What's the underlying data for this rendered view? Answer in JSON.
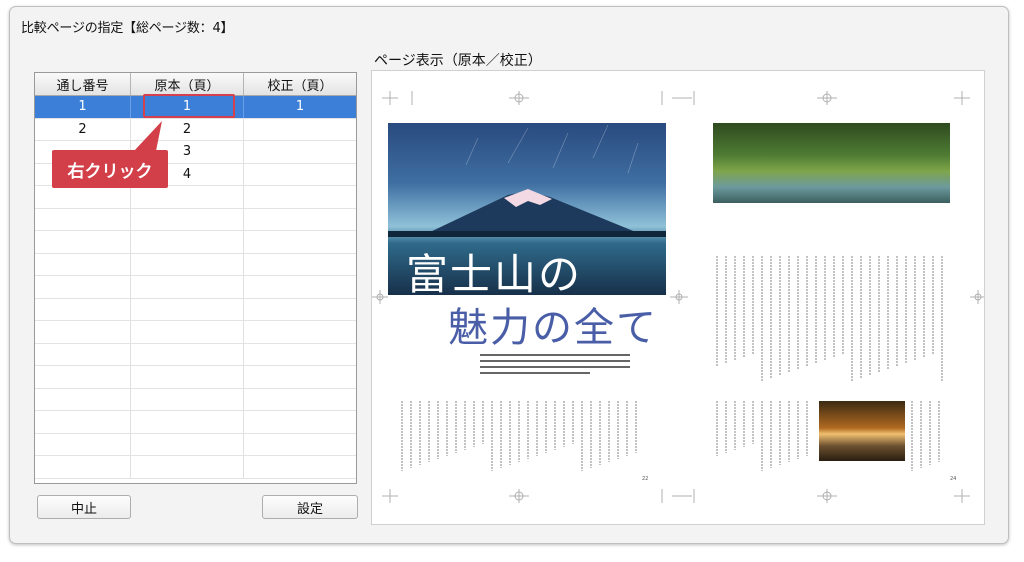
{
  "window": {
    "title": "比較ページの指定【総ページ数：4】"
  },
  "preview": {
    "title": "ページ表示（原本／校正）",
    "left_heading_line1": "富士山の",
    "left_heading_line2": "魅力の全て",
    "left_page_no": "22",
    "right_page_no": "24"
  },
  "table": {
    "headers": [
      "通し番号",
      "原本（頁）",
      "校正（頁）"
    ],
    "rows": [
      [
        "1",
        "1",
        "1"
      ],
      [
        "2",
        "2",
        ""
      ],
      [
        "",
        "3",
        ""
      ],
      [
        "",
        "4",
        ""
      ]
    ],
    "selected_row": 0
  },
  "annotation": {
    "callout_label": "右クリック",
    "color": "#d23f49"
  },
  "buttons": {
    "cancel": "中止",
    "set": "設定"
  },
  "colors": {
    "selection": "#3b7fd8",
    "highlight": "#d4414c",
    "heading_blue": "#4a5ea8"
  }
}
